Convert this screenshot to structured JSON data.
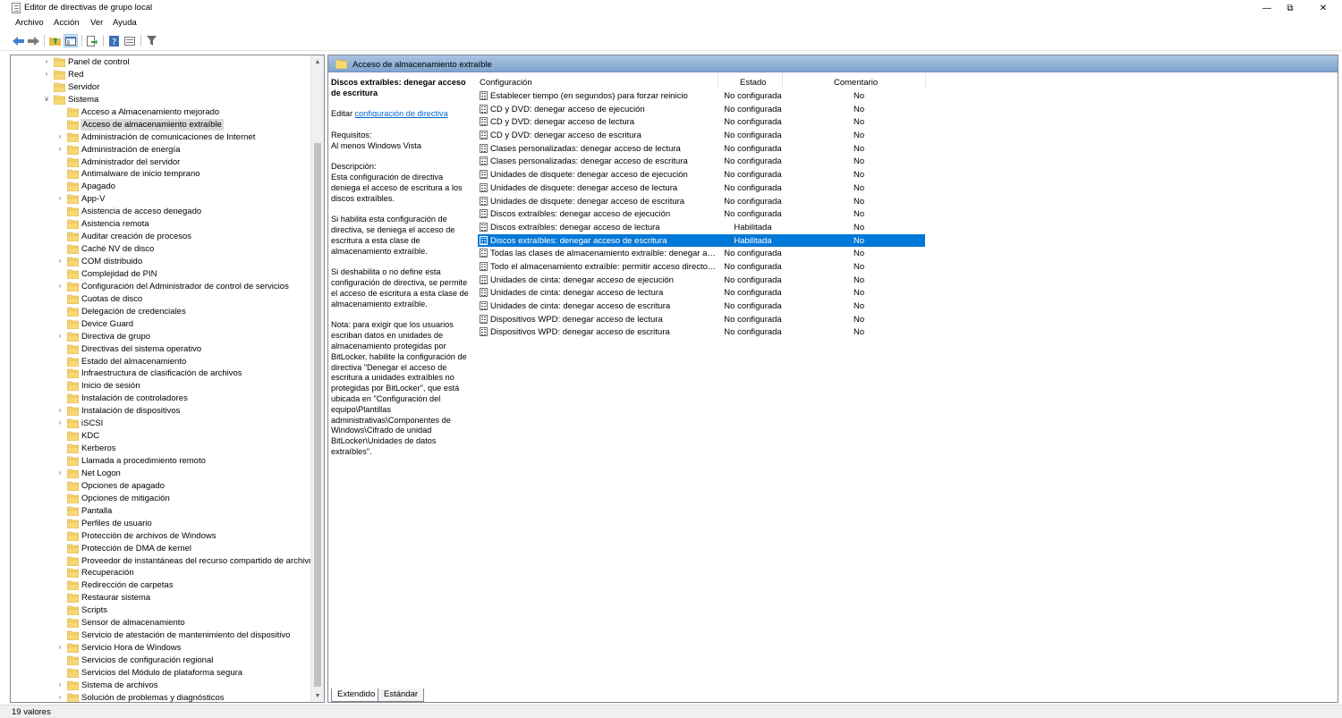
{
  "window": {
    "title": "Editor de directivas de grupo local"
  },
  "menu": [
    "Archivo",
    "Acción",
    "Ver",
    "Ayuda"
  ],
  "toolbar": [
    "back-icon",
    "forward-icon",
    "up-folder-icon",
    "show-hide-tree-icon",
    "export-list-icon",
    "help-icon",
    "properties-icon",
    "filter-icon"
  ],
  "tree": [
    {
      "label": "Panel de control",
      "level": 1,
      "expander": true
    },
    {
      "label": "Red",
      "level": 1,
      "expander": true
    },
    {
      "label": "Servidor",
      "level": 1,
      "expander": false
    },
    {
      "label": "Sistema",
      "level": 1,
      "expander": "open"
    },
    {
      "label": "Acceso a Almacenamiento mejorado",
      "level": 2,
      "expander": false
    },
    {
      "label": "Acceso de almacenamiento extraíble",
      "level": 2,
      "expander": false,
      "selected": true
    },
    {
      "label": "Administración de comunicaciones de Internet",
      "level": 2,
      "expander": true
    },
    {
      "label": "Administración de energía",
      "level": 2,
      "expander": true
    },
    {
      "label": "Administrador del servidor",
      "level": 2,
      "expander": false
    },
    {
      "label": "Antimalware de inicio temprano",
      "level": 2,
      "expander": false
    },
    {
      "label": "Apagado",
      "level": 2,
      "expander": false
    },
    {
      "label": "App-V",
      "level": 2,
      "expander": true
    },
    {
      "label": "Asistencia de acceso denegado",
      "level": 2,
      "expander": false
    },
    {
      "label": "Asistencia remota",
      "level": 2,
      "expander": false
    },
    {
      "label": "Auditar creación de procesos",
      "level": 2,
      "expander": false
    },
    {
      "label": "Caché NV de disco",
      "level": 2,
      "expander": false
    },
    {
      "label": "COM distribuido",
      "level": 2,
      "expander": true
    },
    {
      "label": "Complejidad de PIN",
      "level": 2,
      "expander": false
    },
    {
      "label": "Configuración del Administrador de control de servicios",
      "level": 2,
      "expander": true
    },
    {
      "label": "Cuotas de disco",
      "level": 2,
      "expander": false
    },
    {
      "label": "Delegación de credenciales",
      "level": 2,
      "expander": false
    },
    {
      "label": "Device Guard",
      "level": 2,
      "expander": false
    },
    {
      "label": "Directiva de grupo",
      "level": 2,
      "expander": true
    },
    {
      "label": "Directivas del sistema operativo",
      "level": 2,
      "expander": false
    },
    {
      "label": "Estado del almacenamiento",
      "level": 2,
      "expander": false
    },
    {
      "label": "Infraestructura de clasificación de archivos",
      "level": 2,
      "expander": false
    },
    {
      "label": "Inicio de sesión",
      "level": 2,
      "expander": false
    },
    {
      "label": "Instalación de controladores",
      "level": 2,
      "expander": false
    },
    {
      "label": "Instalación de dispositivos",
      "level": 2,
      "expander": true
    },
    {
      "label": "iSCSI",
      "level": 2,
      "expander": true
    },
    {
      "label": "KDC",
      "level": 2,
      "expander": false
    },
    {
      "label": "Kerberos",
      "level": 2,
      "expander": false
    },
    {
      "label": "Llamada a procedimiento remoto",
      "level": 2,
      "expander": false
    },
    {
      "label": "Net Logon",
      "level": 2,
      "expander": true
    },
    {
      "label": "Opciones de apagado",
      "level": 2,
      "expander": false
    },
    {
      "label": "Opciones de mitigación",
      "level": 2,
      "expander": false
    },
    {
      "label": "Pantalla",
      "level": 2,
      "expander": false
    },
    {
      "label": "Perfiles de usuario",
      "level": 2,
      "expander": false
    },
    {
      "label": "Protección de archivos de Windows",
      "level": 2,
      "expander": false
    },
    {
      "label": "Protección de DMA de kernel",
      "level": 2,
      "expander": false
    },
    {
      "label": "Proveedor de instantáneas del recurso compartido de archivos",
      "level": 2,
      "expander": false
    },
    {
      "label": "Recuperación",
      "level": 2,
      "expander": false
    },
    {
      "label": "Redirección de carpetas",
      "level": 2,
      "expander": false
    },
    {
      "label": "Restaurar sistema",
      "level": 2,
      "expander": false
    },
    {
      "label": "Scripts",
      "level": 2,
      "expander": false
    },
    {
      "label": "Sensor de almacenamiento",
      "level": 2,
      "expander": false
    },
    {
      "label": "Servicio de atestación de mantenimiento del dispositivo",
      "level": 2,
      "expander": false
    },
    {
      "label": "Servicio Hora de Windows",
      "level": 2,
      "expander": true
    },
    {
      "label": "Servicios de configuración regional",
      "level": 2,
      "expander": false
    },
    {
      "label": "Servicios del Módulo de plataforma segura",
      "level": 2,
      "expander": false
    },
    {
      "label": "Sistema de archivos",
      "level": 2,
      "expander": true
    },
    {
      "label": "Solución de problemas y diagnósticos",
      "level": 2,
      "expander": true
    }
  ],
  "right_header": "Acceso de almacenamiento extraíble",
  "description": {
    "title": "Discos extraíbles: denegar acceso de escritura",
    "edit_prefix": "Editar",
    "edit_link": "configuración de directiva",
    "requirements_label": "Requisitos:",
    "requirements_value": "Al menos Windows Vista",
    "description_label": "Descripción:",
    "paragraphs": [
      "Esta configuración de directiva deniega el acceso de escritura a los discos extraíbles.",
      "Si habilita esta configuración de directiva, se deniega el acceso de escritura a esta clase de almacenamiento extraíble.",
      "Si deshabilita o no define esta configuración de directiva, se permite el acceso de escritura a esta clase de almacenamiento extraíble.",
      "Nota: para exigir que los usuarios escriban datos en unidades de almacenamiento protegidas por BitLocker, habilite la configuración de directiva \"Denegar el acceso de escritura a unidades extraíbles no protegidas por BitLocker\", que está ubicada en \"Configuración del equipo\\Plantillas administrativas\\Componentes de Windows\\Cifrado de unidad BitLocker\\Unidades de datos extraíbles\"."
    ]
  },
  "columns": {
    "config": "Configuración",
    "state": "Estado",
    "comment": "Comentario"
  },
  "settings": [
    {
      "name": "Establecer tiempo (en segundos) para forzar reinicio",
      "state": "No configurada",
      "comment": "No"
    },
    {
      "name": "CD y DVD: denegar acceso de ejecución",
      "state": "No configurada",
      "comment": "No"
    },
    {
      "name": "CD y DVD: denegar acceso de lectura",
      "state": "No configurada",
      "comment": "No"
    },
    {
      "name": "CD y DVD: denegar acceso de escritura",
      "state": "No configurada",
      "comment": "No"
    },
    {
      "name": "Clases personalizadas: denegar acceso de lectura",
      "state": "No configurada",
      "comment": "No"
    },
    {
      "name": "Clases personalizadas: denegar acceso de escritura",
      "state": "No configurada",
      "comment": "No"
    },
    {
      "name": "Unidades de disquete: denegar acceso de ejecución",
      "state": "No configurada",
      "comment": "No"
    },
    {
      "name": "Unidades de disquete: denegar acceso de lectura",
      "state": "No configurada",
      "comment": "No"
    },
    {
      "name": "Unidades de disquete: denegar acceso de escritura",
      "state": "No configurada",
      "comment": "No"
    },
    {
      "name": "Discos extraíbles: denegar acceso de ejecución",
      "state": "No configurada",
      "comment": "No"
    },
    {
      "name": "Discos extraíbles: denegar acceso de lectura",
      "state": "Habilitada",
      "comment": "No"
    },
    {
      "name": "Discos extraíbles: denegar acceso de escritura",
      "state": "Habilitada",
      "comment": "No",
      "selected": true
    },
    {
      "name": "Todas las clases de almacenamiento extraíble: denegar acce...",
      "state": "No configurada",
      "comment": "No"
    },
    {
      "name": "Todo el almacenamiento extraíble: permitir acceso directo e...",
      "state": "No configurada",
      "comment": "No"
    },
    {
      "name": "Unidades de cinta: denegar acceso de ejecución",
      "state": "No configurada",
      "comment": "No"
    },
    {
      "name": "Unidades de cinta: denegar acceso de lectura",
      "state": "No configurada",
      "comment": "No"
    },
    {
      "name": "Unidades de cinta: denegar acceso de escritura",
      "state": "No configurada",
      "comment": "No"
    },
    {
      "name": "Dispositivos WPD: denegar acceso de lectura",
      "state": "No configurada",
      "comment": "No"
    },
    {
      "name": "Dispositivos WPD: denegar acceso de escritura",
      "state": "No configurada",
      "comment": "No"
    }
  ],
  "tabs": [
    "Extendido",
    "Estándar"
  ],
  "status": "19 valores",
  "colors": {
    "selection": "#0078d7",
    "header_gradient_top": "#a9c4e2",
    "folder": "#f8d775",
    "link": "#0066cc"
  }
}
